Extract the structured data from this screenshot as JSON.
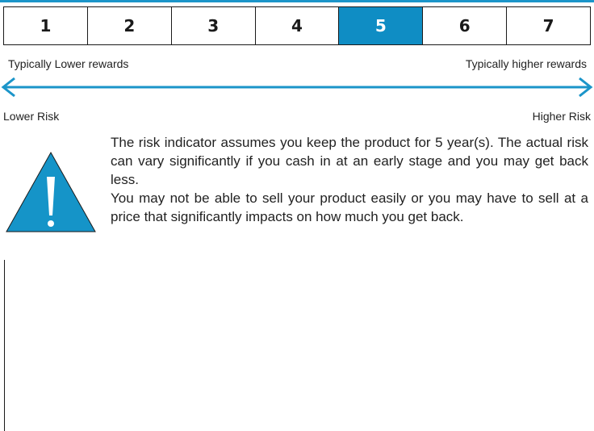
{
  "scale": {
    "levels": [
      "1",
      "2",
      "3",
      "4",
      "5",
      "6",
      "7"
    ],
    "selected": 5
  },
  "labels": {
    "lower_reward": "Typically Lower rewards",
    "higher_reward": "Typically higher rewards",
    "lower_risk": "Lower Risk",
    "higher_risk": "Higher Risk"
  },
  "narrative": {
    "paragraph1": "The risk indicator assumes you keep the product for 5 year(s). The actual risk can vary significantly if you cash in at an early stage and you may get back less.",
    "paragraph2": "You may not be able to sell your product easily or you may have to sell at a price that significantly impacts on how much you get back."
  },
  "icons": {
    "arrow": "double-arrow-icon",
    "warning": "warning-triangle-icon"
  },
  "colors": {
    "accent": "#0f8dc4",
    "arrow": "#1b95c9"
  }
}
